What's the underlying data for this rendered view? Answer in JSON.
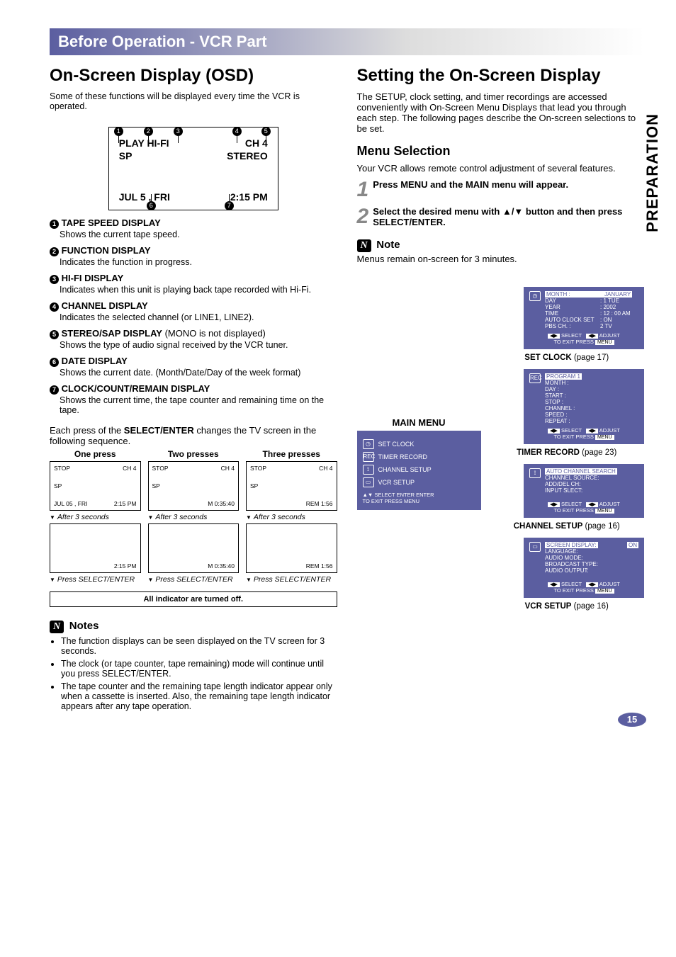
{
  "side_tab": "PREPARATION",
  "banner": "Before Operation - VCR Part",
  "left": {
    "title": "On-Screen Display (OSD)",
    "intro": "Some of these functions will be displayed every time the VCR is operated.",
    "osd": {
      "markers_top": [
        "1",
        "2",
        "3",
        "4",
        "5"
      ],
      "row1_left": "PLAY HI-FI",
      "row1_right": "CH  4",
      "row2_left": "SP",
      "row2_right": "STEREO",
      "row3_left": "JUL   5 , FRI",
      "row3_right": "2:15 PM",
      "markers_bot": [
        "6",
        "7"
      ]
    },
    "items": [
      {
        "num": "1",
        "title": "TAPE SPEED DISPLAY",
        "body": "Shows the current tape speed."
      },
      {
        "num": "2",
        "title": "FUNCTION DISPLAY",
        "body": "Indicates the function in progress."
      },
      {
        "num": "3",
        "title": "HI-FI DISPLAY",
        "body": "Indicates when this unit is playing back tape recorded with Hi-Fi."
      },
      {
        "num": "4",
        "title": "CHANNEL DISPLAY",
        "body": "Indicates the selected channel (or LINE1, LINE2)."
      },
      {
        "num": "5",
        "title": "STEREO/SAP DISPLAY",
        "extra": " (MONO is not displayed)",
        "body": "Shows the type of audio signal received by the VCR tuner."
      },
      {
        "num": "6",
        "title": "DATE DISPLAY",
        "body": "Shows the current date. (Month/Date/Day of the week format)"
      },
      {
        "num": "7",
        "title": "CLOCK/COUNT/REMAIN DISPLAY",
        "body": "Shows the current time, the tape counter and remaining time on the tape."
      }
    ],
    "seq_intro_a": "Each press of the ",
    "seq_intro_b": "SELECT/ENTER",
    "seq_intro_c": " changes the TV screen in the following sequence.",
    "seq_headers": [
      "One press",
      "Two presses",
      "Three presses"
    ],
    "seq_boxes": [
      {
        "tl": "STOP",
        "tr": "CH  4",
        "sp": "SP",
        "bl": "JUL  05 , FRI",
        "br": "2:15 PM",
        "cap": "After 3 seconds",
        "b2r": "2:15 PM",
        "press": "Press SELECT/ENTER"
      },
      {
        "tl": "STOP",
        "tr": "CH  4",
        "sp": "SP",
        "bl": "",
        "br": "M 0:35:40",
        "cap": "After 3 seconds",
        "b2r": "M 0:35:40",
        "press": "Press SELECT/ENTER"
      },
      {
        "tl": "STOP",
        "tr": "CH  4",
        "sp": "SP",
        "bl": "",
        "br": "REM 1:56",
        "cap": "After 3 seconds",
        "b2r": "REM 1:56",
        "press": "Press SELECT/ENTER"
      }
    ],
    "all_off": "All indicator are turned off.",
    "notes_title": "Notes",
    "notes": [
      "The function displays can be seen displayed on the TV screen for 3 seconds.",
      "The clock (or tape counter, tape remaining) mode will continue until you press SELECT/ENTER.",
      "The tape counter and the remaining tape length indicator appear only when a cassette is inserted. Also, the remaining tape length indicator appears after any tape operation."
    ]
  },
  "right": {
    "title": "Setting the On-Screen Display",
    "intro": "The SETUP, clock setting, and timer recordings are accessed conveniently with On-Screen Menu Displays that lead you through each step. The following pages describe the On-screen selections to be set.",
    "menu_sel_title": "Menu Selection",
    "menu_sel_intro": "Your VCR allows remote control adjustment of several features.",
    "step1": "Press MENU and the MAIN menu will appear.",
    "step2": "Select the desired menu with ▲/▼ button and then press SELECT/ENTER.",
    "note_title": "Note",
    "note": "Menus remain on-screen for 3 minutes.",
    "main_menu_title": "MAIN MENU",
    "main_menu_items": [
      "SET CLOCK",
      "TIMER RECORD",
      "CHANNEL SETUP",
      "VCR SETUP"
    ],
    "main_menu_foot1": "▲▼ SELECT  ENTER  ENTER",
    "main_menu_foot2": "TO  EXIT   PRESS  MENU",
    "panels": {
      "set_clock": {
        "caption_b": "SET CLOCK",
        "caption_p": " (page 17)",
        "rows": [
          [
            "MONTH  :",
            "JANUARY"
          ],
          [
            "DAY",
            ": 1  TUE"
          ],
          [
            "YEAR",
            ": 2002"
          ],
          [
            "TIME",
            ": 12 : 00  AM"
          ],
          [
            "AUTO CLOCK SET",
            ": ON"
          ],
          [
            "PBS CH. :",
            "2      TV"
          ]
        ],
        "foot1": "◀▶ SELECT   ◀▶ ADJUST",
        "foot2": "TO  EXIT   PRESS MENU"
      },
      "timer": {
        "caption_b": "TIMER RECORD",
        "caption_p": " (page 23)",
        "program": "PROGRAM  1",
        "rows": [
          "MONTH     :",
          "DAY            :",
          "START       :",
          "STOP          :",
          "CHANNEL  :",
          "SPEED        :",
          "REPEAT      :"
        ],
        "foot1": "◀▶ SELECT   ◀▶ ADJUST",
        "foot2": "TO  EXIT   PRESS MENU"
      },
      "channel": {
        "caption_b": "CHANNEL SETUP",
        "caption_p": " (page 16)",
        "hl": "AUTO  CHANNEL  SEARCH",
        "rows": [
          "CHANNEL  SOURCE:",
          "ADD/DEL  CH:",
          "INPUT  SLECT:"
        ],
        "foot1": "◀▶ SELECT   ◀▶ ADJUST",
        "foot2": "TO  EXIT   PRESS MENU"
      },
      "vcr": {
        "caption_b": "VCR SETUP",
        "caption_p": " (page 16)",
        "hl_l": "SCREEN  DISPLAY:",
        "hl_r": "ON",
        "rows": [
          "LANGUAGE:",
          "AUDIO MODE:",
          "BROADCAST  TYPE:",
          "AUDIO OUTPUT:"
        ],
        "foot1": "◀▶ SELECT   ◀▶ ADJUST",
        "foot2": "TO  EXIT   PRESS MENU"
      }
    }
  },
  "page_num": "15"
}
